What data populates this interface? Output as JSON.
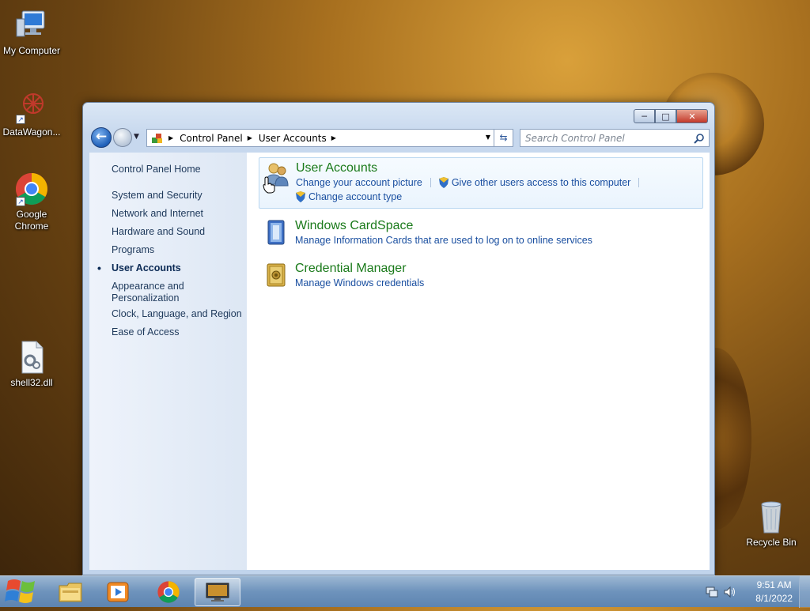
{
  "desktop": {
    "icons": [
      {
        "label": "My Computer",
        "icon": "computer-icon"
      },
      {
        "label": "DataWagon...",
        "icon": "datawagon-icon"
      },
      {
        "label": "Google Chrome",
        "icon": "chrome-icon"
      },
      {
        "label": "shell32.dll",
        "icon": "dll-file-icon"
      },
      {
        "label": "Recycle Bin",
        "icon": "recycle-bin-icon"
      }
    ]
  },
  "window": {
    "title_buttons": {
      "minimize": "─",
      "maximize": "□",
      "close": "✕"
    },
    "breadcrumb": [
      "Control Panel",
      "User Accounts"
    ],
    "search": {
      "placeholder": "Search Control Panel",
      "value": ""
    },
    "left_nav": {
      "home": "Control Panel Home",
      "items": [
        {
          "label": "System and Security",
          "selected": false
        },
        {
          "label": "Network and Internet",
          "selected": false
        },
        {
          "label": "Hardware and Sound",
          "selected": false
        },
        {
          "label": "Programs",
          "selected": false
        },
        {
          "label": "User Accounts",
          "selected": true
        },
        {
          "label": "Appearance and Personalization",
          "selected": false
        },
        {
          "label": "Clock, Language, and Region",
          "selected": false
        },
        {
          "label": "Ease of Access",
          "selected": false
        }
      ]
    },
    "categories": [
      {
        "title": "User Accounts",
        "icon": "user-accounts-icon",
        "links": [
          "Change your account picture",
          "Give other users access to this computer",
          "Change account type"
        ]
      },
      {
        "title": "Windows CardSpace",
        "icon": "cardspace-icon",
        "links": [
          "Manage Information Cards that are used to log on to online services"
        ]
      },
      {
        "title": "Credential Manager",
        "icon": "credential-manager-icon",
        "links": [
          "Manage Windows credentials"
        ]
      }
    ]
  },
  "taskbar": {
    "apps": [
      {
        "name": "file-explorer",
        "icon": "folder-icon"
      },
      {
        "name": "media-player",
        "icon": "media-player-icon"
      },
      {
        "name": "chrome",
        "icon": "chrome-icon"
      },
      {
        "name": "control-panel",
        "icon": "control-panel-icon",
        "active": true
      }
    ],
    "clock": {
      "time": "9:51 AM",
      "date": "8/1/2022"
    }
  },
  "colors": {
    "link": "#1a4fa0",
    "category_title": "#1a7a1a",
    "nav_text": "#1e395b",
    "taskbar": "#6e93bc"
  }
}
